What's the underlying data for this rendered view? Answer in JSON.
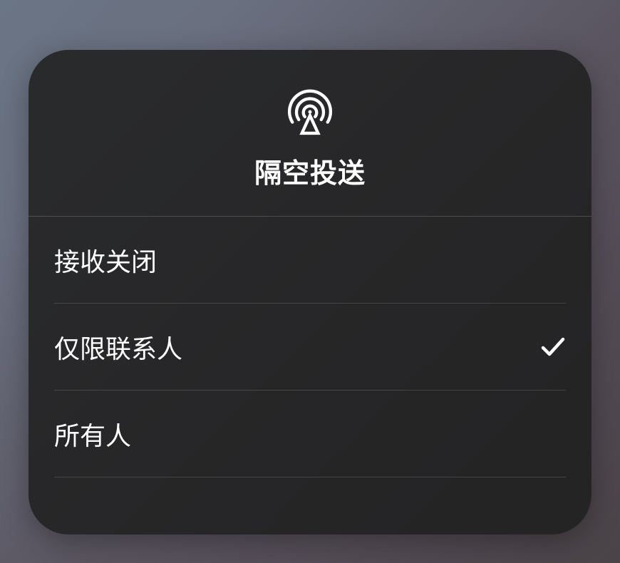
{
  "panel": {
    "title": "隔空投送"
  },
  "menu": {
    "items": [
      {
        "label": "接收关闭",
        "selected": false
      },
      {
        "label": "仅限联系人",
        "selected": true
      },
      {
        "label": "所有人",
        "selected": false
      }
    ]
  }
}
